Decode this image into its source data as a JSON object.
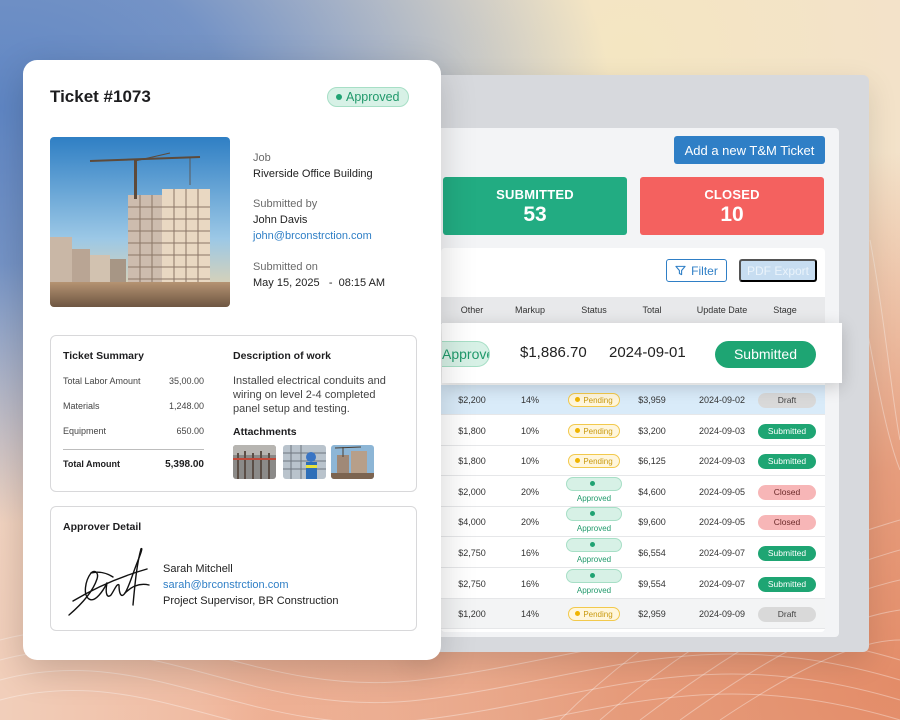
{
  "ticket": {
    "title": "Ticket #1073",
    "status_badge": "Approved",
    "job_label": "Job",
    "job_value": "Riverside Office Building",
    "submitted_by_label": "Submitted by",
    "submitted_by_name": "John Davis",
    "submitted_by_email": "john@brconstrction.com",
    "submitted_on_label": "Submitted on",
    "submitted_on_value": "May 15, 2025   -  08:15 AM",
    "summary": {
      "title": "Ticket Summary",
      "rows": [
        {
          "label": "Total Labor Amount",
          "amount": "35,00.00"
        },
        {
          "label": "Materials",
          "amount": "1,248.00"
        },
        {
          "label": "Equipment",
          "amount": "650.00"
        }
      ],
      "total_label": "Total Amount",
      "total_amount": "5,398.00",
      "description_title": "Description of work",
      "description_text": "Installed electrical conduits and wiring on level 2-4 completed panel setup and testing.",
      "attachments_title": "Attachments"
    },
    "approver": {
      "title": "Approver Detail",
      "name": "Sarah Mitchell",
      "email": "sarah@brconstrction.com",
      "role": "Project Supervisor, BR Construction"
    }
  },
  "dashboard": {
    "add_button": "Add a new T&M Ticket",
    "stats": [
      {
        "label": "SUBMITTED",
        "value": "53",
        "color": "#22ac82"
      },
      {
        "label": "CLOSED",
        "value": "10",
        "color": "#f4615f"
      }
    ],
    "filter_button": "Filter",
    "pdf_button": "PDF Export",
    "columns": [
      "Other",
      "Markup",
      "Status",
      "Total",
      "Update Date",
      "Stage"
    ],
    "highlight_row": {
      "status": "Approved",
      "total": "$1,886.70",
      "date": "2024-09-01",
      "stage": "Submitted"
    },
    "rows": [
      {
        "other": "$2,200",
        "markup": "14%",
        "status": "Pending",
        "total": "$3,959",
        "date": "2024-09-02",
        "stage": "Draft"
      },
      {
        "other": "$1,800",
        "markup": "10%",
        "status": "Pending",
        "total": "$3,200",
        "date": "2024-09-03",
        "stage": "Submitted"
      },
      {
        "other": "$1,800",
        "markup": "10%",
        "status": "Pending",
        "total": "$6,125",
        "date": "2024-09-03",
        "stage": "Submitted"
      },
      {
        "other": "$2,000",
        "markup": "20%",
        "status": "Approved",
        "total": "$4,600",
        "date": "2024-09-05",
        "stage": "Closed"
      },
      {
        "other": "$4,000",
        "markup": "20%",
        "status": "Approved",
        "total": "$9,600",
        "date": "2024-09-05",
        "stage": "Closed"
      },
      {
        "other": "$2,750",
        "markup": "16%",
        "status": "Approved",
        "total": "$6,554",
        "date": "2024-09-07",
        "stage": "Submitted"
      },
      {
        "other": "$2,750",
        "markup": "16%",
        "status": "Approved",
        "total": "$9,554",
        "date": "2024-09-07",
        "stage": "Submitted"
      },
      {
        "other": "$1,200",
        "markup": "14%",
        "status": "Pending",
        "total": "$2,959",
        "date": "2024-09-09",
        "stage": "Draft"
      }
    ]
  }
}
